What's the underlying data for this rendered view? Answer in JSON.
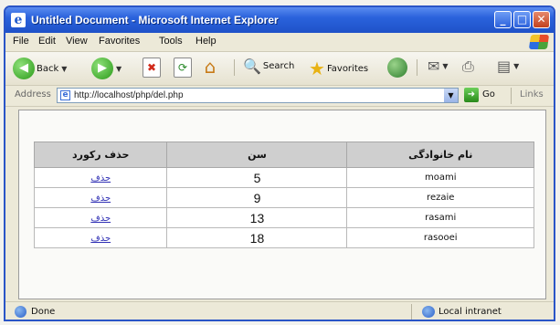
{
  "window": {
    "title": "Untitled Document - Microsoft Internet Explorer"
  },
  "menu": [
    "File",
    "Edit",
    "View",
    "Favorites",
    "Tools",
    "Help"
  ],
  "toolbar": {
    "back_label": "Back",
    "search_label": "Search",
    "favorites_label": "Favorites"
  },
  "address": {
    "label": "Address",
    "url": "http://localhost/php/del.php",
    "go_label": "Go",
    "links_label": "Links"
  },
  "table": {
    "headers": [
      "حذف رکورد",
      "سن",
      "نام خانوادگی"
    ],
    "rows": [
      {
        "action": "حذف",
        "age": "5",
        "name": "moami"
      },
      {
        "action": "حذف",
        "age": "9",
        "name": "rezaie"
      },
      {
        "action": "حذف",
        "age": "13",
        "name": "rasami"
      },
      {
        "action": "حذف",
        "age": "18",
        "name": "rasooei"
      }
    ]
  },
  "status": {
    "text": "Done",
    "zone": "Local intranet"
  }
}
